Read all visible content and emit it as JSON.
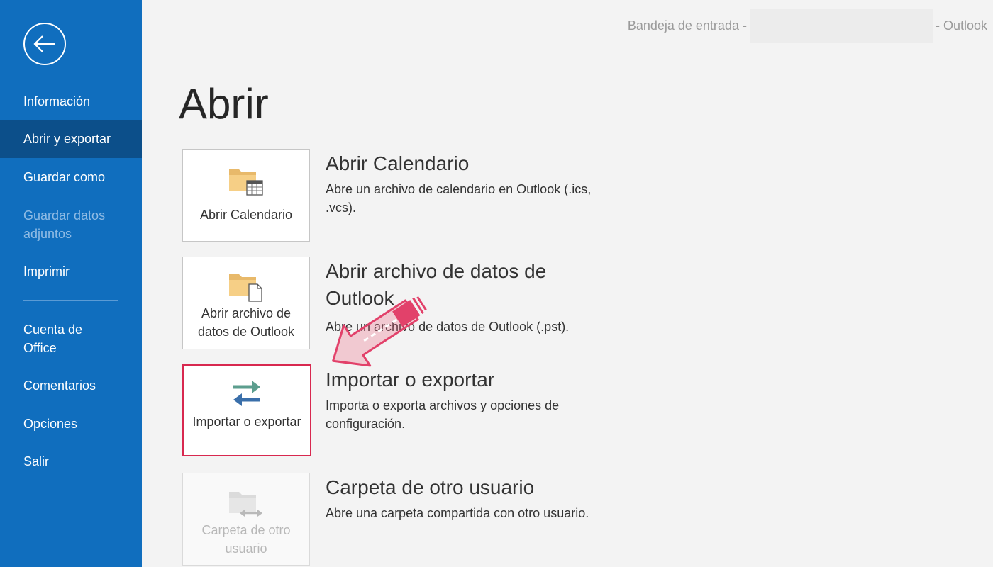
{
  "window": {
    "title_prefix": "Bandeja de entrada -",
    "title_suffix": "-  Outlook"
  },
  "sidebar": {
    "back_icon": "back-arrow-icon",
    "items": [
      {
        "label": "Información",
        "state": "normal"
      },
      {
        "label": "Abrir y exportar",
        "state": "selected"
      },
      {
        "label": "Guardar como",
        "state": "normal"
      },
      {
        "label": "Guardar datos adjuntos",
        "state": "disabled"
      },
      {
        "label": "Imprimir",
        "state": "normal"
      },
      {
        "label": "Cuenta de Office",
        "state": "normal"
      },
      {
        "label": "Comentarios",
        "state": "normal"
      },
      {
        "label": "Opciones",
        "state": "normal"
      },
      {
        "label": "Salir",
        "state": "normal"
      }
    ]
  },
  "main": {
    "title": "Abrir",
    "options": [
      {
        "tile_label": "Abrir Calendario",
        "icon": "folder-calendar-icon",
        "heading": "Abrir Calendario",
        "description": "Abre un archivo de calendario en Outlook (.ics, .vcs)."
      },
      {
        "tile_label": "Abrir archivo de datos de Outlook",
        "icon": "folder-file-icon",
        "heading": "Abrir archivo de datos de Outlook",
        "description": "Abre un archivo de datos de Outlook (.pst)."
      },
      {
        "tile_label": "Importar o exportar",
        "icon": "import-export-arrows-icon",
        "heading": "Importar o exportar",
        "description": "Importa o exporta archivos y opciones de configuración."
      },
      {
        "tile_label": "Carpeta de otro usuario",
        "icon": "shared-folder-icon",
        "heading": "Carpeta de otro usuario",
        "description": "Abre una carpeta compartida con otro usuario."
      }
    ]
  },
  "colors": {
    "sidebar": "#106ebe",
    "sidebar_selected": "#0c4f8a",
    "highlight": "#d8284f"
  }
}
